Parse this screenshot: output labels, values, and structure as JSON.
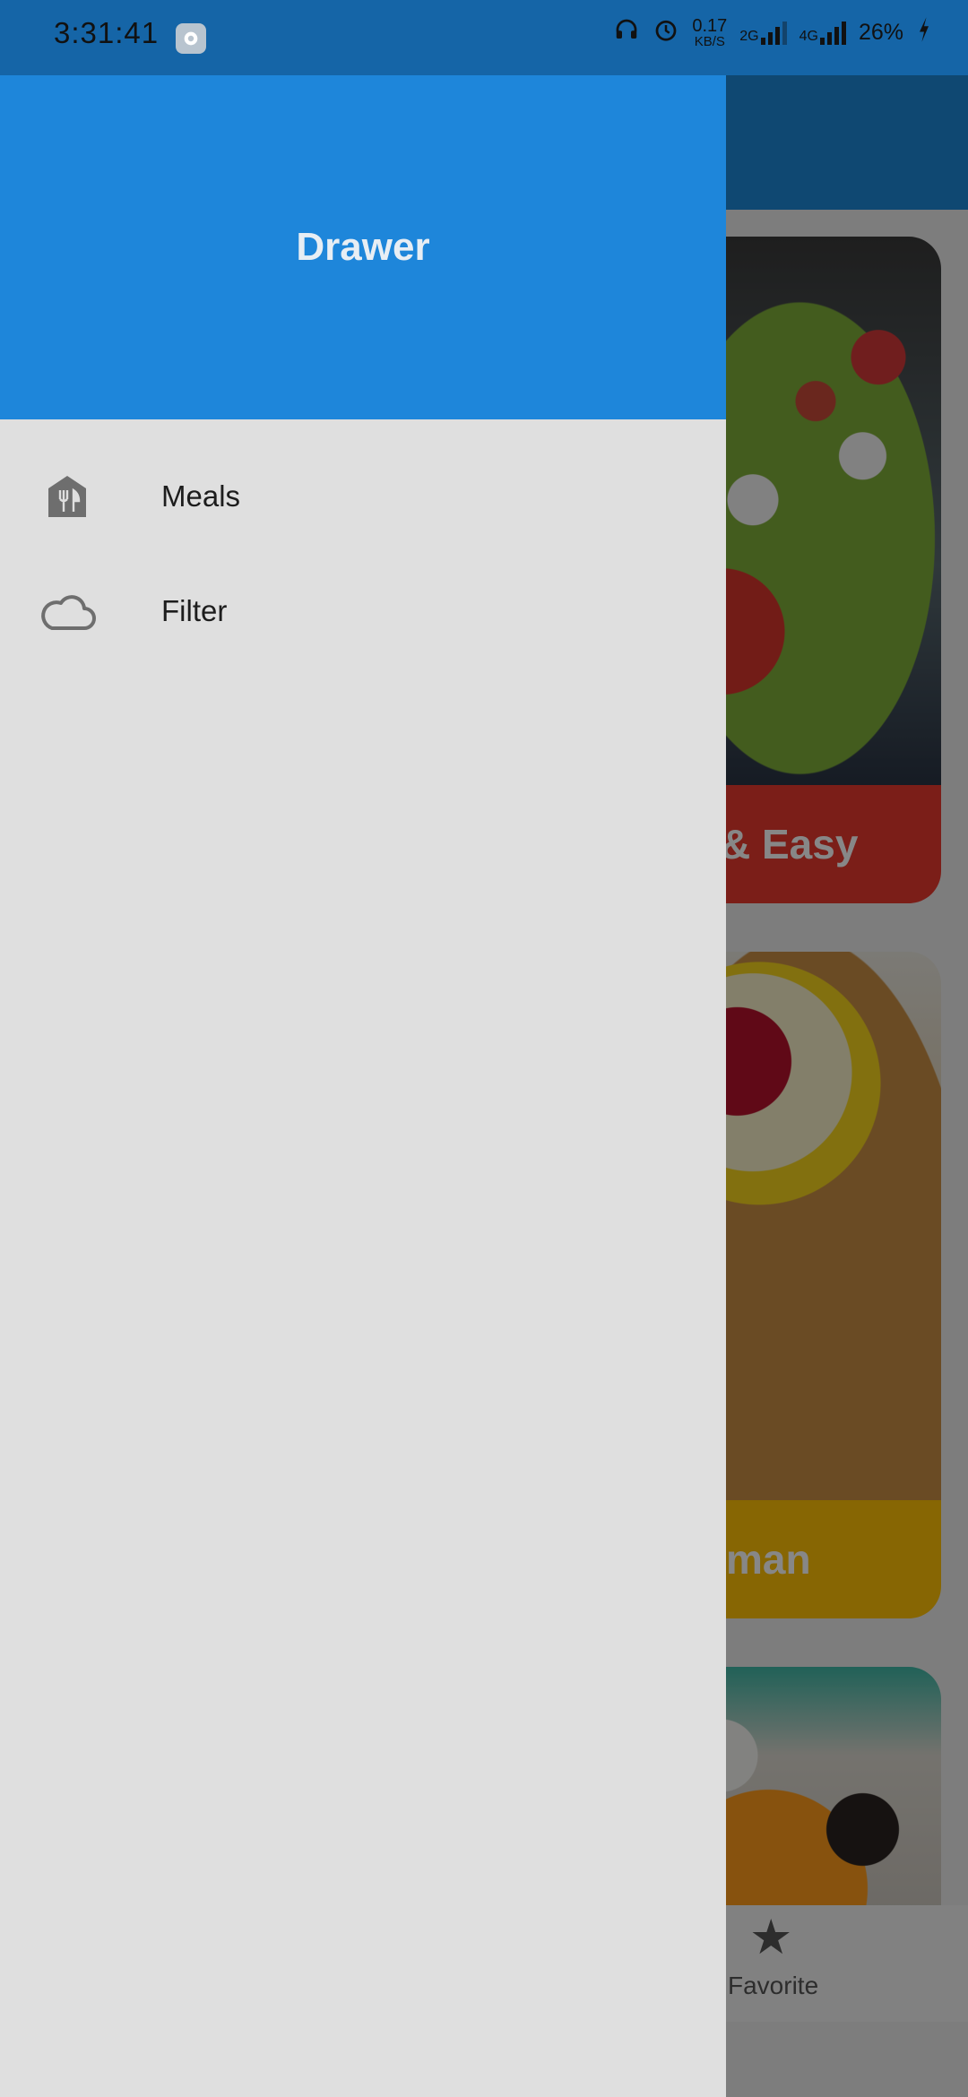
{
  "status_bar": {
    "time": "3:31:41",
    "speed_value": "0.17",
    "speed_unit": "KB/S",
    "network_1": "2G",
    "network_2": "4G",
    "battery": "26%"
  },
  "background_app": {
    "cards": [
      {
        "title": "& Easy",
        "color": "#e8392f"
      },
      {
        "title": "man",
        "color": "#ffc107"
      },
      {
        "title": "",
        "color": "#3fb8a6"
      }
    ],
    "bottom_nav": {
      "favorite_label": "Favorite",
      "icon": "star-icon"
    }
  },
  "drawer": {
    "header_title": "Drawer",
    "header_color": "#1e86da",
    "items": [
      {
        "label": "Meals",
        "icon": "restaurant-icon"
      },
      {
        "label": "Filter",
        "icon": "cloud-icon"
      }
    ]
  }
}
